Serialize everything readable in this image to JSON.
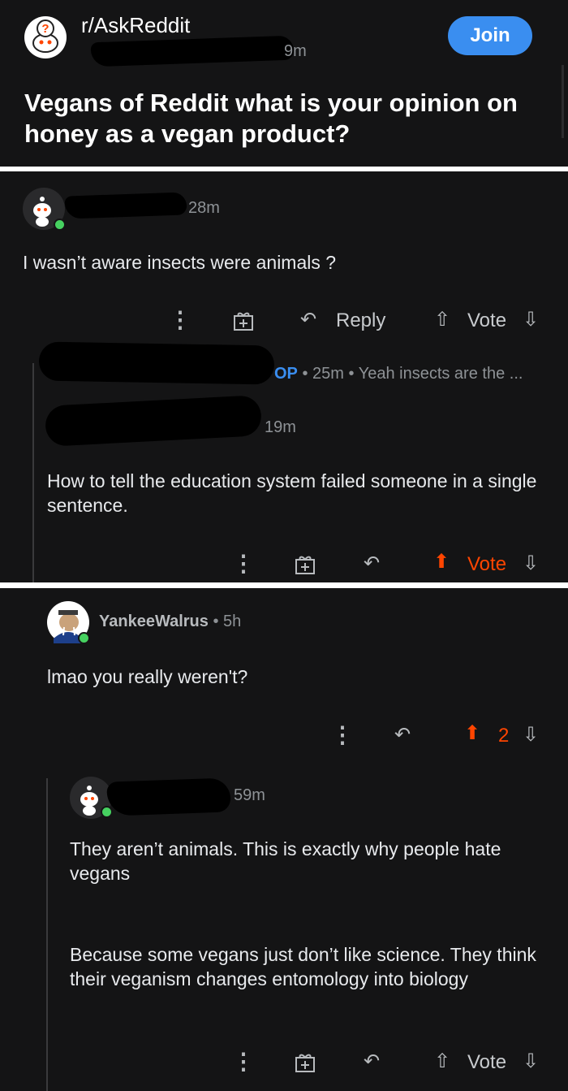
{
  "post": {
    "subreddit": "r/AskReddit",
    "time": "9m",
    "join_label": "Join",
    "title": "Vegans of Reddit what is your opinion on honey as a vegan product?"
  },
  "comment1": {
    "time": "28m",
    "body": "I wasn’t aware insects were animals ?",
    "reply_label": "Reply",
    "vote_label": "Vote"
  },
  "comment1_collapsed": {
    "op_badge": "OP",
    "time": "25m",
    "preview": "Yeah insects are the ..."
  },
  "comment2": {
    "time": "19m",
    "body": "How to tell the education system failed someone in a single sentence.",
    "vote_label": "Vote"
  },
  "comment3": {
    "username": "YankeeWalrus",
    "time": "5h",
    "body": "lmao you really weren't?",
    "votes": "2"
  },
  "comment4": {
    "time": "59m",
    "body_p1": "They aren’t animals. This is exactly why people hate vegans",
    "body_p2": "Because some vegans just don’t like science. They think their veganism changes entomology into biology",
    "vote_label": "Vote"
  },
  "colors": {
    "accent": "#3a8ef0",
    "upvote": "#ff4500",
    "online": "#46d160"
  }
}
